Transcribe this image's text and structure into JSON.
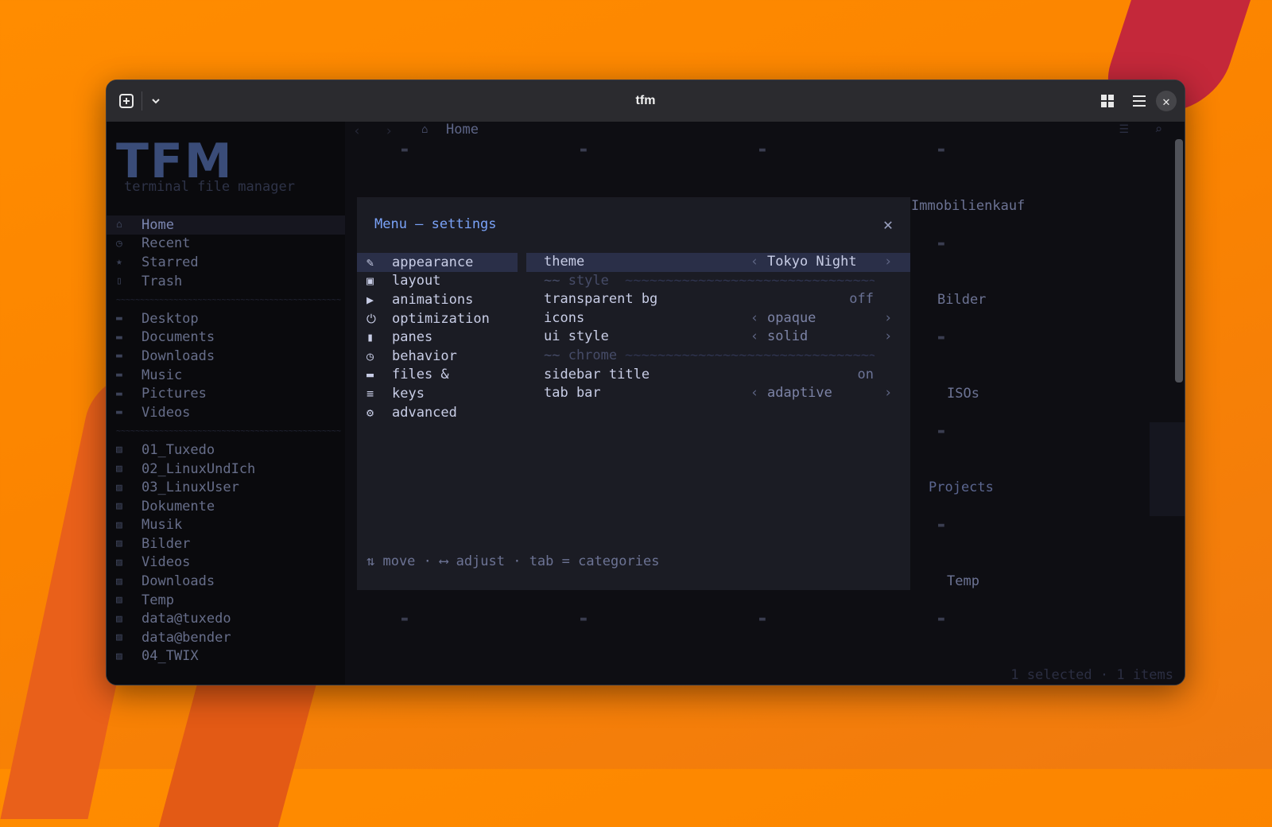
{
  "window": {
    "title": "tfm",
    "new_tab_icon": "new-tab-icon",
    "view_icon": "grid-view-icon",
    "menu_icon": "hamburger-menu-icon",
    "close_glyph": "✕"
  },
  "sidebar": {
    "logo": "TFM",
    "logo_subtitle": "terminal file manager",
    "places": [
      {
        "label": "Home",
        "icon": "home-icon",
        "active": true
      },
      {
        "label": "Recent",
        "icon": "clock-icon"
      },
      {
        "label": "Starred",
        "icon": "star-icon"
      },
      {
        "label": "Trash",
        "icon": "trash-icon"
      }
    ],
    "folders": [
      {
        "label": "Desktop",
        "icon": "folder-icon"
      },
      {
        "label": "Documents",
        "icon": "folder-icon"
      },
      {
        "label": "Downloads",
        "icon": "folder-icon"
      },
      {
        "label": "Music",
        "icon": "folder-icon"
      },
      {
        "label": "Pictures",
        "icon": "folder-icon"
      },
      {
        "label": "Videos",
        "icon": "folder-icon"
      }
    ],
    "bookmarks": [
      "01_Tuxedo",
      "02_LinuxUndIch",
      "03_LinuxUser",
      "Dokumente",
      "Musik",
      "Bilder",
      "Videos",
      "Downloads",
      "Temp",
      "data@tuxedo",
      "data@bender",
      "04_TWIX"
    ]
  },
  "main": {
    "breadcrumb": "Home",
    "background_items": [
      "Immobilienkauf",
      "Bilder",
      "ISOs",
      "Projects",
      "Temp"
    ],
    "status": "1 selected · 1 items"
  },
  "modal": {
    "title": "Menu — settings",
    "close_glyph": "✕",
    "categories": [
      {
        "label": "appearance",
        "icon": "pencil-icon",
        "glyph": "✎",
        "active": true
      },
      {
        "label": "layout",
        "icon": "layout-icon",
        "glyph": "▣"
      },
      {
        "label": "animations",
        "icon": "play-icon",
        "glyph": "▶"
      },
      {
        "label": "optimization",
        "icon": "power-icon",
        "glyph": "⏻"
      },
      {
        "label": "panes",
        "icon": "panes-icon",
        "glyph": "▮"
      },
      {
        "label": "behavior",
        "icon": "clock-icon",
        "glyph": "◷"
      },
      {
        "label": "files &",
        "icon": "folder-icon",
        "glyph": "▬"
      },
      {
        "label": "keys",
        "icon": "lines-icon",
        "glyph": "≡"
      },
      {
        "label": "advanced",
        "icon": "gear-icon",
        "glyph": "⚙"
      }
    ],
    "settings": {
      "theme": {
        "label": "theme",
        "value": "Tokyo Night"
      },
      "section_style": "~~ style",
      "transparent_bg": {
        "label": "transparent bg",
        "value": "off"
      },
      "icons": {
        "label": "icons",
        "value": "opaque"
      },
      "ui_style": {
        "label": "ui style",
        "value": "solid"
      },
      "section_chrome": "~~ chrome",
      "sidebar_title": {
        "label": "sidebar title",
        "value": "on"
      },
      "tab_bar": {
        "label": "tab bar",
        "value": "adaptive"
      }
    },
    "arrow_left": "‹",
    "arrow_right": "›",
    "footer": "⇅ move · ⟷ adjust · tab = categories"
  }
}
